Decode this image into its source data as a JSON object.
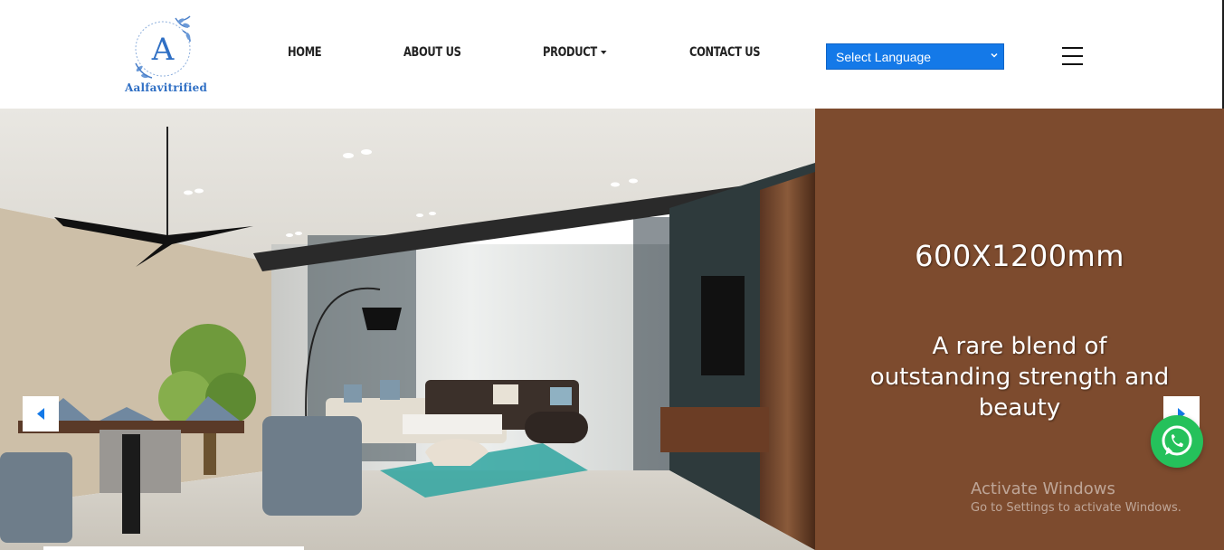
{
  "brand": {
    "logo_letter": "A",
    "name": "Aalfavitrified"
  },
  "nav": {
    "items": [
      {
        "label": "HOME"
      },
      {
        "label": "ABOUT US"
      },
      {
        "label": "PRODUCT"
      },
      {
        "label": "CONTACT US"
      }
    ]
  },
  "language": {
    "selected": "Select Language"
  },
  "hero": {
    "size": "600X1200mm",
    "tagline": "A rare blend of outstanding strength and beauty"
  },
  "overlay": {
    "activate_title": "Activate Windows",
    "activate_sub": "Go to Settings to activate Windows."
  },
  "colors": {
    "panel": "#7d4b2e",
    "accent": "#1479e8",
    "whatsapp": "#25c15b"
  }
}
